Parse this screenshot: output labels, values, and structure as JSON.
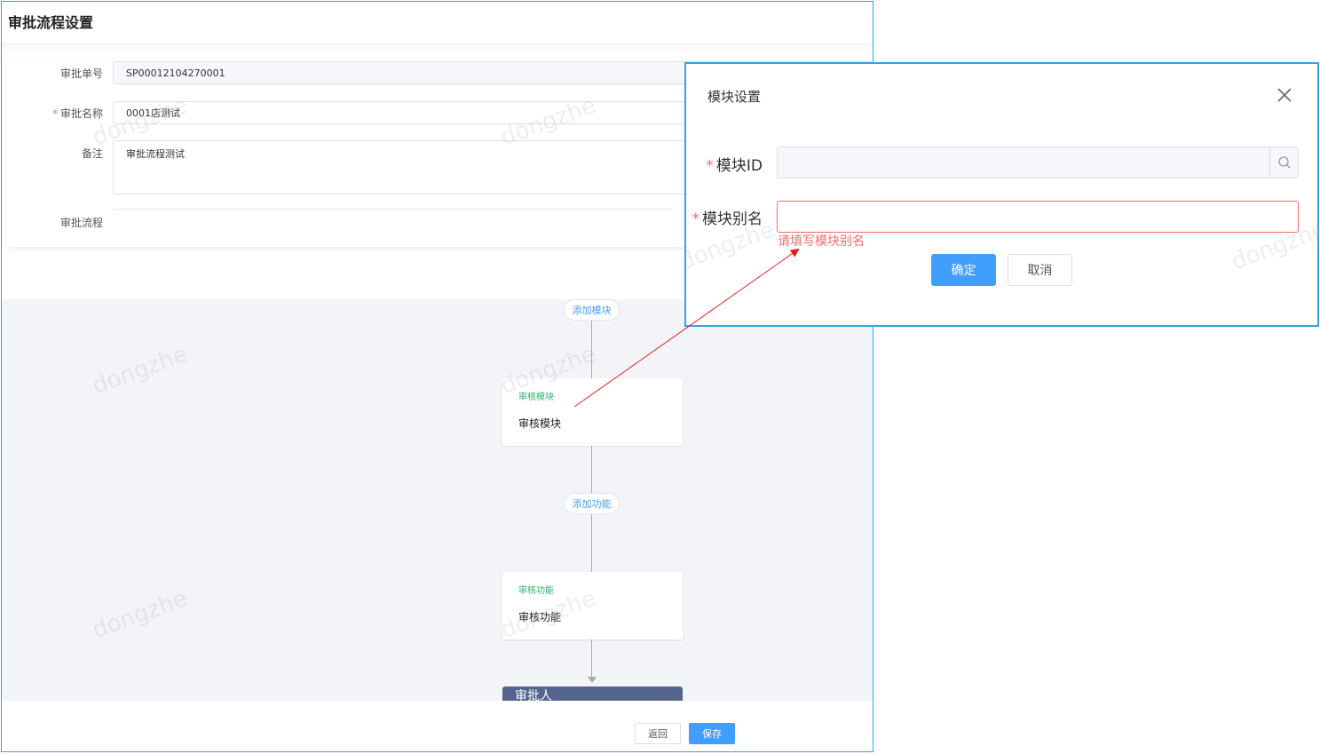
{
  "page": {
    "title": "审批流程设置",
    "watermark": "dongzhe"
  },
  "form": {
    "order_no": {
      "label": "审批单号",
      "value": "SP00012104270001"
    },
    "name": {
      "label": "审批名称",
      "value": "0001店测试"
    },
    "remark": {
      "label": "备注",
      "value": "审批流程测试"
    },
    "flow": {
      "label": "审批流程"
    }
  },
  "flow": {
    "add_module_label": "添加模块",
    "add_function_label": "添加功能",
    "module_node": {
      "tag": "审核模块",
      "name": "审核模块"
    },
    "function_node": {
      "tag": "审核功能",
      "name": "审核功能"
    },
    "approver_label": "审批人"
  },
  "footer": {
    "back_label": "返回",
    "save_label": "保存"
  },
  "dialog": {
    "title": "模块设置",
    "module_id_label": "模块ID",
    "module_id_value": "",
    "module_alias_label": "模块别名",
    "module_alias_value": "",
    "error_text": "请填写模块别名",
    "ok_label": "确定",
    "cancel_label": "取消"
  },
  "colors": {
    "primary": "#409eff",
    "error": "#f56c6c",
    "panel_border": "#2fa4e7",
    "node_tag": "#29b26a",
    "approver_bg": "#55648c",
    "annotation_arrow": "#e02020"
  },
  "icons": [
    "close-icon",
    "search-icon",
    "arrow-down-icon"
  ]
}
